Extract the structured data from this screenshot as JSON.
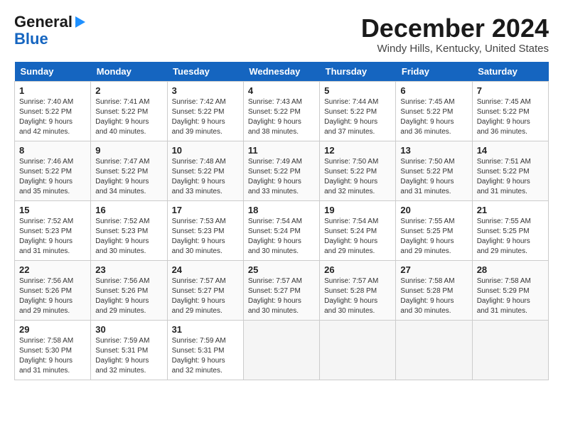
{
  "logo": {
    "line1": "General",
    "line2": "Blue",
    "arrow": "▶"
  },
  "title": "December 2024",
  "subtitle": "Windy Hills, Kentucky, United States",
  "days_of_week": [
    "Sunday",
    "Monday",
    "Tuesday",
    "Wednesday",
    "Thursday",
    "Friday",
    "Saturday"
  ],
  "weeks": [
    [
      {
        "day": "1",
        "info": "Sunrise: 7:40 AM\nSunset: 5:22 PM\nDaylight: 9 hours\nand 42 minutes."
      },
      {
        "day": "2",
        "info": "Sunrise: 7:41 AM\nSunset: 5:22 PM\nDaylight: 9 hours\nand 40 minutes."
      },
      {
        "day": "3",
        "info": "Sunrise: 7:42 AM\nSunset: 5:22 PM\nDaylight: 9 hours\nand 39 minutes."
      },
      {
        "day": "4",
        "info": "Sunrise: 7:43 AM\nSunset: 5:22 PM\nDaylight: 9 hours\nand 38 minutes."
      },
      {
        "day": "5",
        "info": "Sunrise: 7:44 AM\nSunset: 5:22 PM\nDaylight: 9 hours\nand 37 minutes."
      },
      {
        "day": "6",
        "info": "Sunrise: 7:45 AM\nSunset: 5:22 PM\nDaylight: 9 hours\nand 36 minutes."
      },
      {
        "day": "7",
        "info": "Sunrise: 7:45 AM\nSunset: 5:22 PM\nDaylight: 9 hours\nand 36 minutes."
      }
    ],
    [
      {
        "day": "8",
        "info": "Sunrise: 7:46 AM\nSunset: 5:22 PM\nDaylight: 9 hours\nand 35 minutes."
      },
      {
        "day": "9",
        "info": "Sunrise: 7:47 AM\nSunset: 5:22 PM\nDaylight: 9 hours\nand 34 minutes."
      },
      {
        "day": "10",
        "info": "Sunrise: 7:48 AM\nSunset: 5:22 PM\nDaylight: 9 hours\nand 33 minutes."
      },
      {
        "day": "11",
        "info": "Sunrise: 7:49 AM\nSunset: 5:22 PM\nDaylight: 9 hours\nand 33 minutes."
      },
      {
        "day": "12",
        "info": "Sunrise: 7:50 AM\nSunset: 5:22 PM\nDaylight: 9 hours\nand 32 minutes."
      },
      {
        "day": "13",
        "info": "Sunrise: 7:50 AM\nSunset: 5:22 PM\nDaylight: 9 hours\nand 31 minutes."
      },
      {
        "day": "14",
        "info": "Sunrise: 7:51 AM\nSunset: 5:22 PM\nDaylight: 9 hours\nand 31 minutes."
      }
    ],
    [
      {
        "day": "15",
        "info": "Sunrise: 7:52 AM\nSunset: 5:23 PM\nDaylight: 9 hours\nand 31 minutes."
      },
      {
        "day": "16",
        "info": "Sunrise: 7:52 AM\nSunset: 5:23 PM\nDaylight: 9 hours\nand 30 minutes."
      },
      {
        "day": "17",
        "info": "Sunrise: 7:53 AM\nSunset: 5:23 PM\nDaylight: 9 hours\nand 30 minutes."
      },
      {
        "day": "18",
        "info": "Sunrise: 7:54 AM\nSunset: 5:24 PM\nDaylight: 9 hours\nand 30 minutes."
      },
      {
        "day": "19",
        "info": "Sunrise: 7:54 AM\nSunset: 5:24 PM\nDaylight: 9 hours\nand 29 minutes."
      },
      {
        "day": "20",
        "info": "Sunrise: 7:55 AM\nSunset: 5:25 PM\nDaylight: 9 hours\nand 29 minutes."
      },
      {
        "day": "21",
        "info": "Sunrise: 7:55 AM\nSunset: 5:25 PM\nDaylight: 9 hours\nand 29 minutes."
      }
    ],
    [
      {
        "day": "22",
        "info": "Sunrise: 7:56 AM\nSunset: 5:26 PM\nDaylight: 9 hours\nand 29 minutes."
      },
      {
        "day": "23",
        "info": "Sunrise: 7:56 AM\nSunset: 5:26 PM\nDaylight: 9 hours\nand 29 minutes."
      },
      {
        "day": "24",
        "info": "Sunrise: 7:57 AM\nSunset: 5:27 PM\nDaylight: 9 hours\nand 29 minutes."
      },
      {
        "day": "25",
        "info": "Sunrise: 7:57 AM\nSunset: 5:27 PM\nDaylight: 9 hours\nand 30 minutes."
      },
      {
        "day": "26",
        "info": "Sunrise: 7:57 AM\nSunset: 5:28 PM\nDaylight: 9 hours\nand 30 minutes."
      },
      {
        "day": "27",
        "info": "Sunrise: 7:58 AM\nSunset: 5:28 PM\nDaylight: 9 hours\nand 30 minutes."
      },
      {
        "day": "28",
        "info": "Sunrise: 7:58 AM\nSunset: 5:29 PM\nDaylight: 9 hours\nand 31 minutes."
      }
    ],
    [
      {
        "day": "29",
        "info": "Sunrise: 7:58 AM\nSunset: 5:30 PM\nDaylight: 9 hours\nand 31 minutes."
      },
      {
        "day": "30",
        "info": "Sunrise: 7:59 AM\nSunset: 5:31 PM\nDaylight: 9 hours\nand 32 minutes."
      },
      {
        "day": "31",
        "info": "Sunrise: 7:59 AM\nSunset: 5:31 PM\nDaylight: 9 hours\nand 32 minutes."
      },
      null,
      null,
      null,
      null
    ]
  ]
}
